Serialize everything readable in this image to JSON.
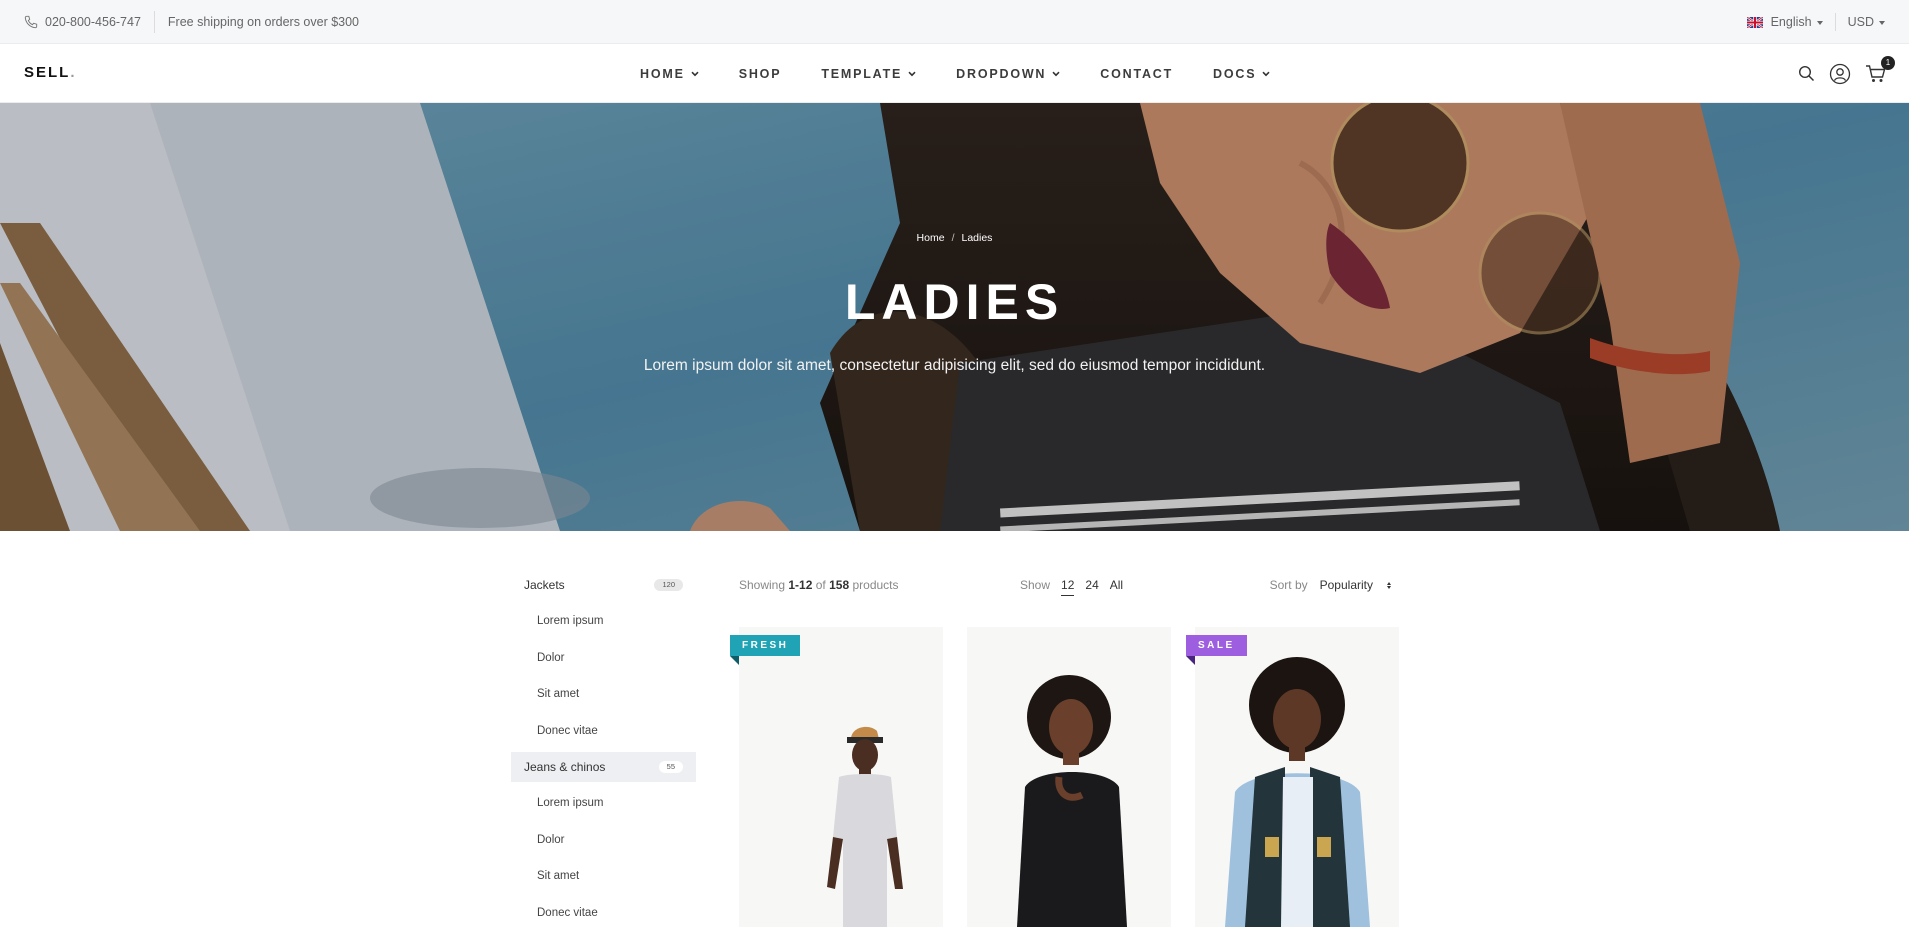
{
  "topbar": {
    "phone": "020-800-456-747",
    "shipping": "Free shipping on orders over $300",
    "language": "English",
    "currency": "USD"
  },
  "nav": {
    "brand": "SELL",
    "brand_dot": ".",
    "items": [
      {
        "label": "HOME",
        "dropdown": true
      },
      {
        "label": "SHOP",
        "dropdown": false
      },
      {
        "label": "TEMPLATE",
        "dropdown": true
      },
      {
        "label": "DROPDOWN",
        "dropdown": true
      },
      {
        "label": "CONTACT",
        "dropdown": false
      },
      {
        "label": "DOCS",
        "dropdown": true
      }
    ],
    "cart_count": "1"
  },
  "hero": {
    "breadcrumb": [
      "Home",
      "Ladies"
    ],
    "title": "LADIES",
    "subtitle": "Lorem ipsum dolor sit amet, consectetur adipisicing elit, sed do eiusmod tempor incididunt."
  },
  "sidebar": {
    "categories": [
      {
        "label": "Jackets",
        "count": "120",
        "active": false,
        "sub": [
          "Lorem ipsum",
          "Dolor",
          "Sit amet",
          "Donec vitae"
        ]
      },
      {
        "label": "Jeans & chinos",
        "count": "55",
        "active": true,
        "sub": [
          "Lorem ipsum",
          "Dolor",
          "Sit amet",
          "Donec vitae"
        ]
      }
    ]
  },
  "toolbar": {
    "showing_prefix": "Showing",
    "range": "1-12",
    "of": "of",
    "total": "158",
    "products_word": "products",
    "show_label": "Show",
    "page_sizes": [
      "12",
      "24",
      "All"
    ],
    "active_page_size": "12",
    "sort_label": "Sort by",
    "sort_value": "Popularity"
  },
  "products": [
    {
      "badge": "FRESH",
      "badge_color": "#1fa3b5"
    },
    {
      "badge": "",
      "badge_color": ""
    },
    {
      "badge": "SALE",
      "badge_color": "#9d5fe0"
    }
  ],
  "colors": {
    "fresh": "#1fa3b5",
    "sale": "#9d5fe0",
    "text_dark": "#333333",
    "topbar_bg": "#f6f7f9"
  }
}
